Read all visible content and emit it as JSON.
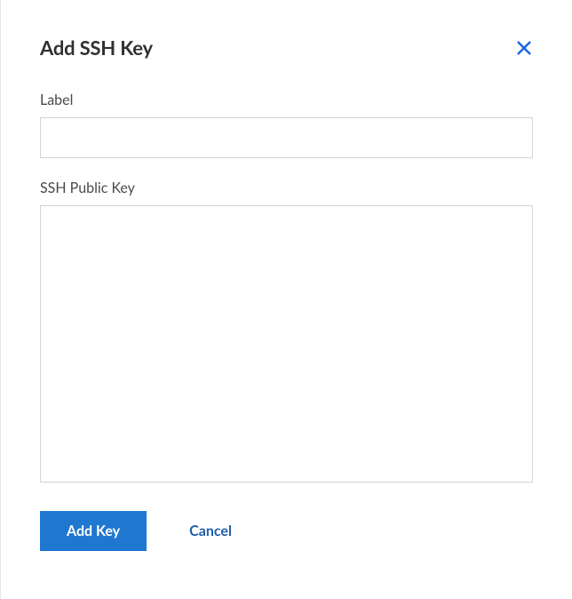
{
  "header": {
    "title": "Add SSH Key"
  },
  "fields": {
    "label": {
      "label_text": "Label",
      "value": "",
      "placeholder": ""
    },
    "ssh_public_key": {
      "label_text": "SSH Public Key",
      "value": "",
      "placeholder": ""
    }
  },
  "actions": {
    "submit_label": "Add Key",
    "cancel_label": "Cancel"
  }
}
